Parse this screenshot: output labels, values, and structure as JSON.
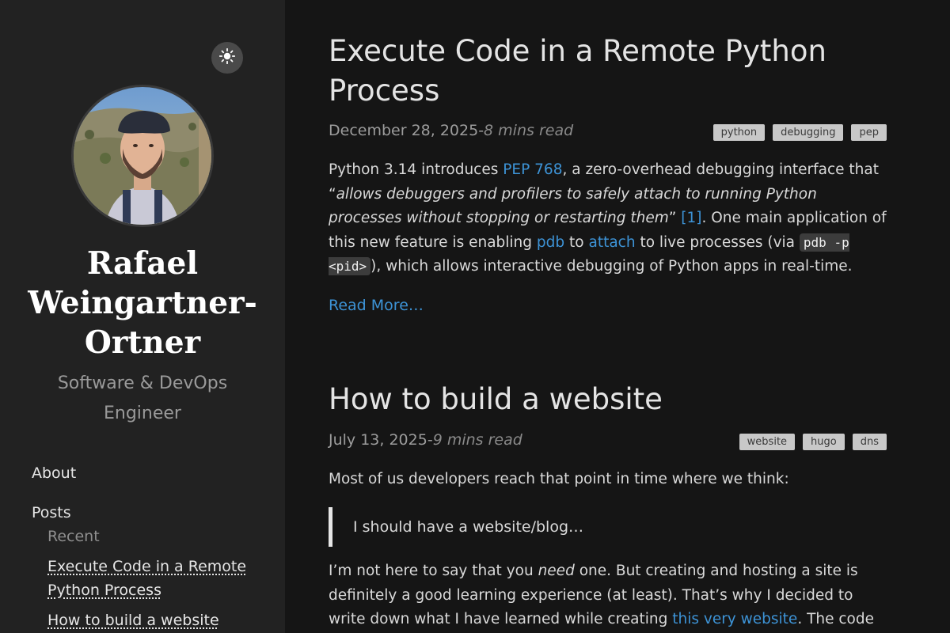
{
  "sidebar": {
    "author_name": "Rafael Weingartner-Ortner",
    "author_role": "Software & DevOps Engineer",
    "theme_toggle_icon": "sun-icon",
    "nav": {
      "about": "About",
      "posts": "Posts",
      "recent": "Recent",
      "recent_posts": [
        "Execute Code in a Remote Python Process",
        "How to build a website"
      ]
    }
  },
  "posts": [
    {
      "title": "Execute Code in a Remote Python Process",
      "date": "December 28, 2025",
      "separator": "-",
      "read_time": "8 mins read",
      "tags": [
        "python",
        "debugging",
        "pep"
      ],
      "excerpt": {
        "t1": "Python 3.14 introduces ",
        "l1": "PEP 768",
        "t2": ", a zero-overhead debugging interface that “",
        "em1": "allows debuggers and profilers to safely attach to running Python processes without stopping or restarting them",
        "t3": "” ",
        "l2": "[1]",
        "t4": ". One main application of this new feature is enabling ",
        "l3": "pdb",
        "t5": " to ",
        "l4": "attach",
        "t6": " to live processes (via ",
        "code1": "pdb -p <pid>",
        "t7": "), which allows interactive debugging of Python apps in real-time."
      },
      "read_more": "Read More…"
    },
    {
      "title": "How to build a website",
      "date": "July 13, 2025",
      "separator": "-",
      "read_time": "9 mins read",
      "tags": [
        "website",
        "hugo",
        "dns"
      ],
      "intro": "Most of us developers reach that point in time where we think:",
      "quote": "I should have a website/blog…",
      "body": {
        "t1": "I’m not here to say that you ",
        "em1": "need",
        "t2": " one. But creating and hosting a site is definitely a good learning experience (at least). That’s why I decided to write down what I have learned while creating ",
        "l1": "this very website",
        "t3": ". The code is"
      }
    }
  ],
  "colors": {
    "sidebar_bg": "#222222",
    "main_bg": "#151515",
    "link": "#3d93d6",
    "tag_bg": "#c8c8c8"
  }
}
